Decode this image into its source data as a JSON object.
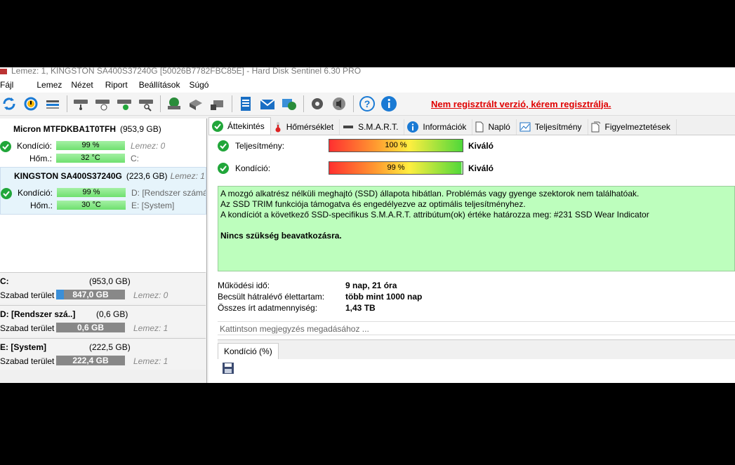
{
  "window": {
    "title": "Lemez: 1, KINGSTON SA400S37240G [50026B7782FBC85E]  -  Hard Disk Sentinel 6.30 PRO"
  },
  "menu": [
    "Fájl",
    "Lemez",
    "Nézet",
    "Riport",
    "Beállítások",
    "Súgó"
  ],
  "toolbar": {
    "register_link": "Nem regisztrált verzió, kérem regisztrálja."
  },
  "disks": [
    {
      "name": "Micron MTFDKBA1T0TFH",
      "size": "(953,9 GB)",
      "kondicio_label": "Kondíció:",
      "kondicio": "99 %",
      "hom_label": "Hőm.:",
      "hom": "32 °C",
      "info1": "Lemez: 0",
      "info2": "C:"
    },
    {
      "name": "KINGSTON SA400S37240G",
      "size": "(223,6 GB)",
      "lemez": "Lemez: 1",
      "kondicio_label": "Kondíció:",
      "kondicio": "99 %",
      "hom_label": "Hőm.:",
      "hom": "30 °C",
      "info1": "D: [Rendszer számár",
      "info2": "E: [System]"
    }
  ],
  "volumes": [
    {
      "name": "C:",
      "size": "(953,0 GB)",
      "free_label": "Szabad terület",
      "free": "847,0 GB",
      "used_fraction": 0.11,
      "lemez": "Lemez: 0"
    },
    {
      "name": "D: [Rendszer szá..]",
      "size": "(0,6 GB)",
      "free_label": "Szabad terület",
      "free": "0,6 GB",
      "used_fraction": 0.0,
      "lemez": "Lemez: 1"
    },
    {
      "name": "E: [System]",
      "size": "(222,5 GB)",
      "free_label": "Szabad terület",
      "free": "222,4 GB",
      "used_fraction": 0.0,
      "lemez": "Lemez: 1"
    }
  ],
  "tabs": [
    "Áttekintés",
    "Hőmérséklet",
    "S.M.A.R.T.",
    "Információk",
    "Napló",
    "Teljesítmény",
    "Figyelmeztetések"
  ],
  "overview": {
    "performance_label": "Teljesítmény:",
    "performance_value": "100 %",
    "performance_fraction": 1.0,
    "performance_rating": "Kiváló",
    "health_label": "Kondíció:",
    "health_value": "99 %",
    "health_fraction": 0.99,
    "health_rating": "Kiváló",
    "messages": [
      "A mozgó alkatrész nélküli meghajtó (SSD) állapota hibátlan. Problémás vagy gyenge szektorok nem találhatóak.",
      "Az SSD TRIM funkciója támogatva és engedélyezve az optimális teljesítményhez.",
      "A kondíciót a következő SSD-specifikus S.M.A.R.T. attribútum(ok) értéke határozza meg:  #231 SSD Wear Indicator"
    ],
    "conclusion": "Nincs szükség beavatkozásra.",
    "stats": [
      {
        "label": "Működési idő:",
        "value": "9 nap, 21 óra"
      },
      {
        "label": "Becsült hátralévő élettartam:",
        "value": "több mint 1000 nap"
      },
      {
        "label": "Összes írt adatmennyiség:",
        "value": "1,43 TB"
      }
    ],
    "note_placeholder": "Kattintson megjegyzés megadásához ...",
    "chart_tab": "Kondíció  (%)"
  }
}
